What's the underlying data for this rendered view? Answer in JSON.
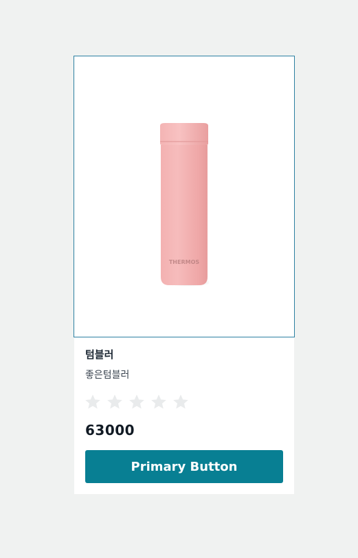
{
  "product": {
    "name": "텀블러",
    "description": "좋은텀블러",
    "price": "63000",
    "rating": 0,
    "rating_max": 5,
    "image_brand_text": "THERMOS",
    "image_color": "#f2aeae"
  },
  "actions": {
    "primary_label": "Primary Button"
  },
  "colors": {
    "page_background": "#f0f2f1",
    "card_background": "#ffffff",
    "image_border": "#2a7fa1",
    "button_background": "#087f93",
    "star_empty": "#e9ebec"
  }
}
